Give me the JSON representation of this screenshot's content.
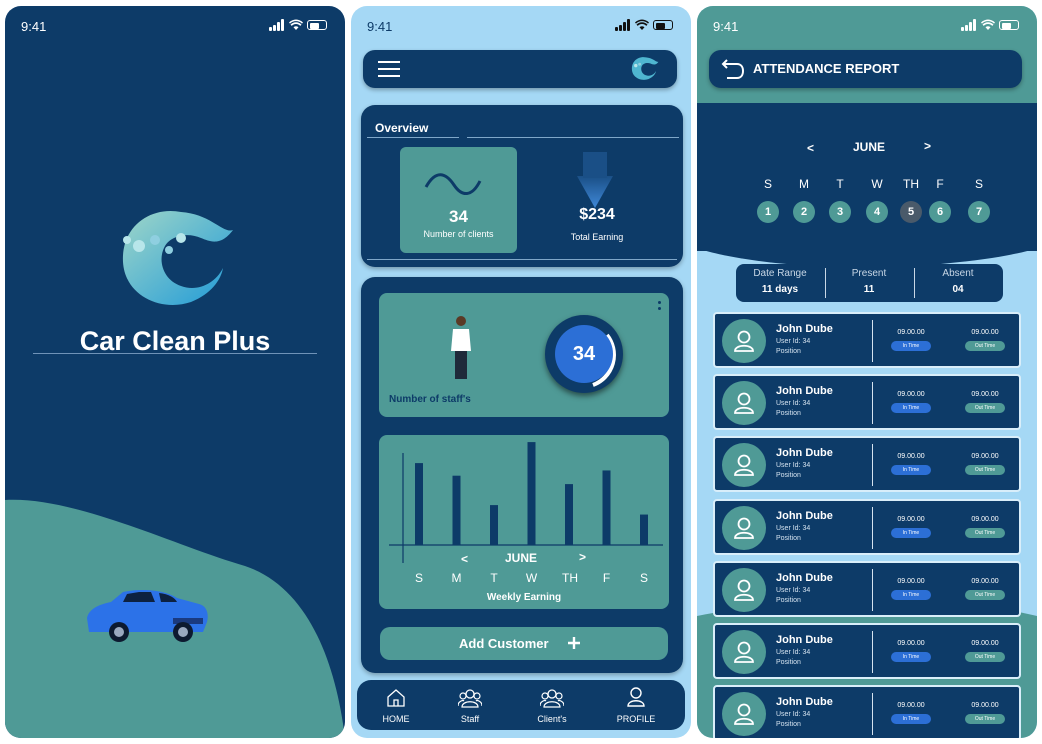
{
  "status_time": "9:41",
  "colors": {
    "navy": "#0d3b68",
    "teal": "#4f9a96",
    "sky": "#a5d8f5",
    "blue": "#2c6fd6"
  },
  "splash": {
    "app_name": "Car Clean Plus"
  },
  "dashboard": {
    "overview_label": "Overview",
    "clients_count": "34",
    "clients_label": "Number of clients",
    "earning_value": "$234",
    "earning_label": "Total Earning",
    "staff_count": "34",
    "staff_label": "Number of staff's",
    "chart_month": "JUNE",
    "chart_prev": "<",
    "chart_next": ">",
    "chart_title": "Weekly Earning",
    "add_customer_label": "Add Customer",
    "add_icon": "plus-icon",
    "nav": [
      {
        "label": "HOME",
        "icon": "home-icon"
      },
      {
        "label": "Staff",
        "icon": "staff-icon"
      },
      {
        "label": "Client's",
        "icon": "clients-icon"
      },
      {
        "label": "PROFILE",
        "icon": "profile-icon"
      }
    ]
  },
  "chart_data": {
    "type": "bar",
    "categories": [
      "S",
      "M",
      "T",
      "W",
      "TH",
      "F",
      "S"
    ],
    "values": [
      78,
      66,
      38,
      98,
      58,
      71,
      29
    ],
    "title": "Weekly Earning",
    "xlabel": "JUNE",
    "ylabel": "",
    "ylim": [
      0,
      100
    ],
    "grid": false
  },
  "report": {
    "title": "ATTENDANCE REPORT",
    "month": "JUNE",
    "prev": "<",
    "next": ">",
    "day_names": [
      "S",
      "M",
      "T",
      "W",
      "TH",
      "F",
      "S"
    ],
    "dates": [
      "1",
      "2",
      "3",
      "4",
      "5",
      "6",
      "7"
    ],
    "selected_date": "5",
    "summary": {
      "range_label": "Date Range",
      "range_value": "11 days",
      "present_label": "Present",
      "present_value": "11",
      "absent_label": "Absent",
      "absent_value": "04"
    },
    "employees": [
      {
        "name": "John Dube",
        "user_id": "User Id: 34",
        "position": "Position",
        "in_time": "09.00.00",
        "in_label": "In Time",
        "out_time": "09.00.00",
        "out_label": "Out Time"
      },
      {
        "name": "John Dube",
        "user_id": "User Id: 34",
        "position": "Position",
        "in_time": "09.00.00",
        "in_label": "In Time",
        "out_time": "09.00.00",
        "out_label": "Out Time"
      },
      {
        "name": "John Dube",
        "user_id": "User Id: 34",
        "position": "Position",
        "in_time": "09.00.00",
        "in_label": "In Time",
        "out_time": "09.00.00",
        "out_label": "Out Time"
      },
      {
        "name": "John Dube",
        "user_id": "User Id: 34",
        "position": "Position",
        "in_time": "09.00.00",
        "in_label": "In Time",
        "out_time": "09.00.00",
        "out_label": "Out Time"
      },
      {
        "name": "John Dube",
        "user_id": "User Id: 34",
        "position": "Position",
        "in_time": "09.00.00",
        "in_label": "In Time",
        "out_time": "09.00.00",
        "out_label": "Out Time"
      },
      {
        "name": "John Dube",
        "user_id": "User Id: 34",
        "position": "Position",
        "in_time": "09.00.00",
        "in_label": "In Time",
        "out_time": "09.00.00",
        "out_label": "Out Time"
      },
      {
        "name": "John Dube",
        "user_id": "User Id: 34",
        "position": "Position",
        "in_time": "09.00.00",
        "in_label": "In Time",
        "out_time": "09.00.00",
        "out_label": "Out Time"
      }
    ]
  }
}
